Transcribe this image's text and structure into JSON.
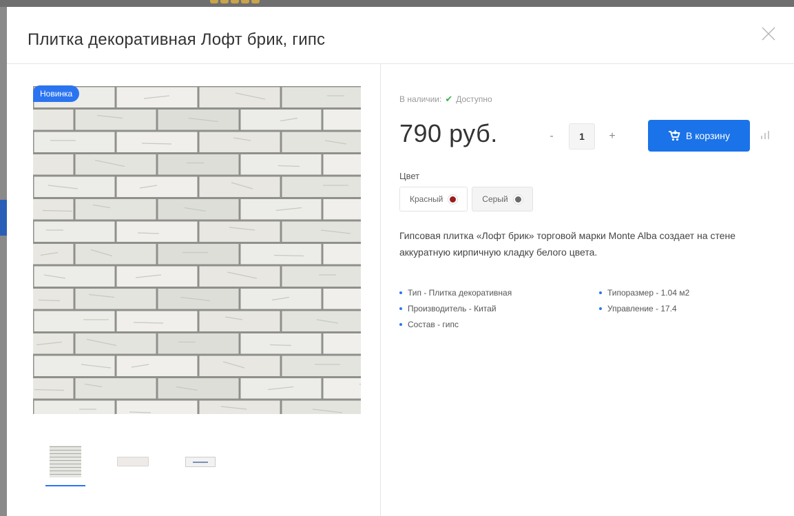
{
  "product": {
    "title": "Плитка декоративная Лофт брик, гипс",
    "badge": "Новинка",
    "stock_label": "В наличии:",
    "stock_status": "Доступно",
    "price": "790 руб.",
    "quantity": "1",
    "qty_minus": "-",
    "qty_plus": "+",
    "cart_label": "В корзину",
    "color_label": "Цвет",
    "colors": [
      {
        "name": "Красный",
        "swatch": "#9b1c1c"
      },
      {
        "name": "Серый",
        "swatch": "#6a6a6a"
      }
    ],
    "description": "Гипсовая плитка «Лофт брик» торговой марки Monte Alba создает на стене аккуратную кирпичную кладку белого цвета.",
    "properties": [
      "Тип - Плитка декоративная",
      "Типоразмер - 1.04 м2",
      "Производитель - Китай",
      "Управление - 17.4",
      "Состав - гипс"
    ]
  },
  "colors": {
    "accent": "#1a73e8",
    "badge": "#2b74f0",
    "in_stock_check": "#3bb34a"
  },
  "icons": {
    "close": "close-icon",
    "check": "check-icon",
    "cart": "cart-icon",
    "compare": "compare-icon"
  }
}
